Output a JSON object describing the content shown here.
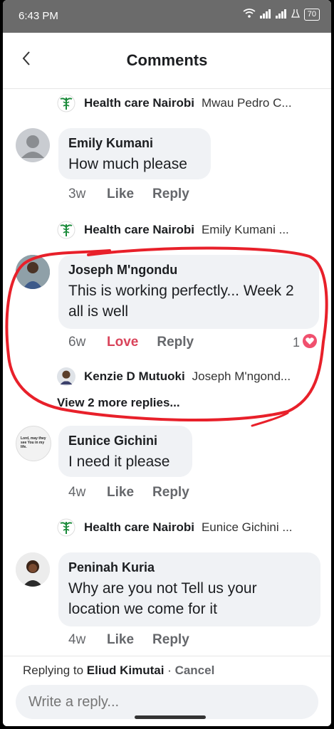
{
  "status_bar": {
    "time": "6:43 PM",
    "battery": "70"
  },
  "header": {
    "title": "Comments"
  },
  "thread": [
    {
      "type": "reply",
      "name": "Health care Nairobi",
      "text": "Mwau Pedro C..."
    },
    {
      "type": "comment",
      "author": "Emily Kumani",
      "text": "How much please",
      "time": "3w",
      "reaction_label": "Like",
      "reply_label": "Reply"
    },
    {
      "type": "reply",
      "name": "Health care Nairobi",
      "text": "Emily Kumani ..."
    },
    {
      "type": "comment",
      "author": "Joseph M'ngondu",
      "text": "This is working perfectly... Week 2 all is well",
      "time": "6w",
      "reaction_label": "Love",
      "reply_label": "Reply",
      "reaction_count": "1"
    },
    {
      "type": "reply",
      "name": "Kenzie D Mutuoki",
      "text": "Joseph M'ngond..."
    },
    {
      "type": "view_more",
      "text": "View 2 more replies..."
    },
    {
      "type": "comment",
      "author": "Eunice Gichini",
      "text": "I need it please",
      "time": "4w",
      "reaction_label": "Like",
      "reply_label": "Reply"
    },
    {
      "type": "reply",
      "name": "Health care Nairobi",
      "text": "Eunice Gichini ..."
    },
    {
      "type": "comment",
      "author": "Peninah Kuria",
      "text": "Why are you not Tell us your location we come for it",
      "time": "4w",
      "reaction_label": "Like",
      "reply_label": "Reply"
    }
  ],
  "eunice_avatar_text": "Lord, may they see You in my life.",
  "composer": {
    "replying_prefix": "Replying to",
    "replying_name": "Eliud Kimutai",
    "separator": "·",
    "cancel_label": "Cancel",
    "placeholder": "Write a reply..."
  },
  "colors": {
    "love": "#d9435a",
    "annotation": "#e8202a",
    "bubble": "#f0f2f5"
  }
}
